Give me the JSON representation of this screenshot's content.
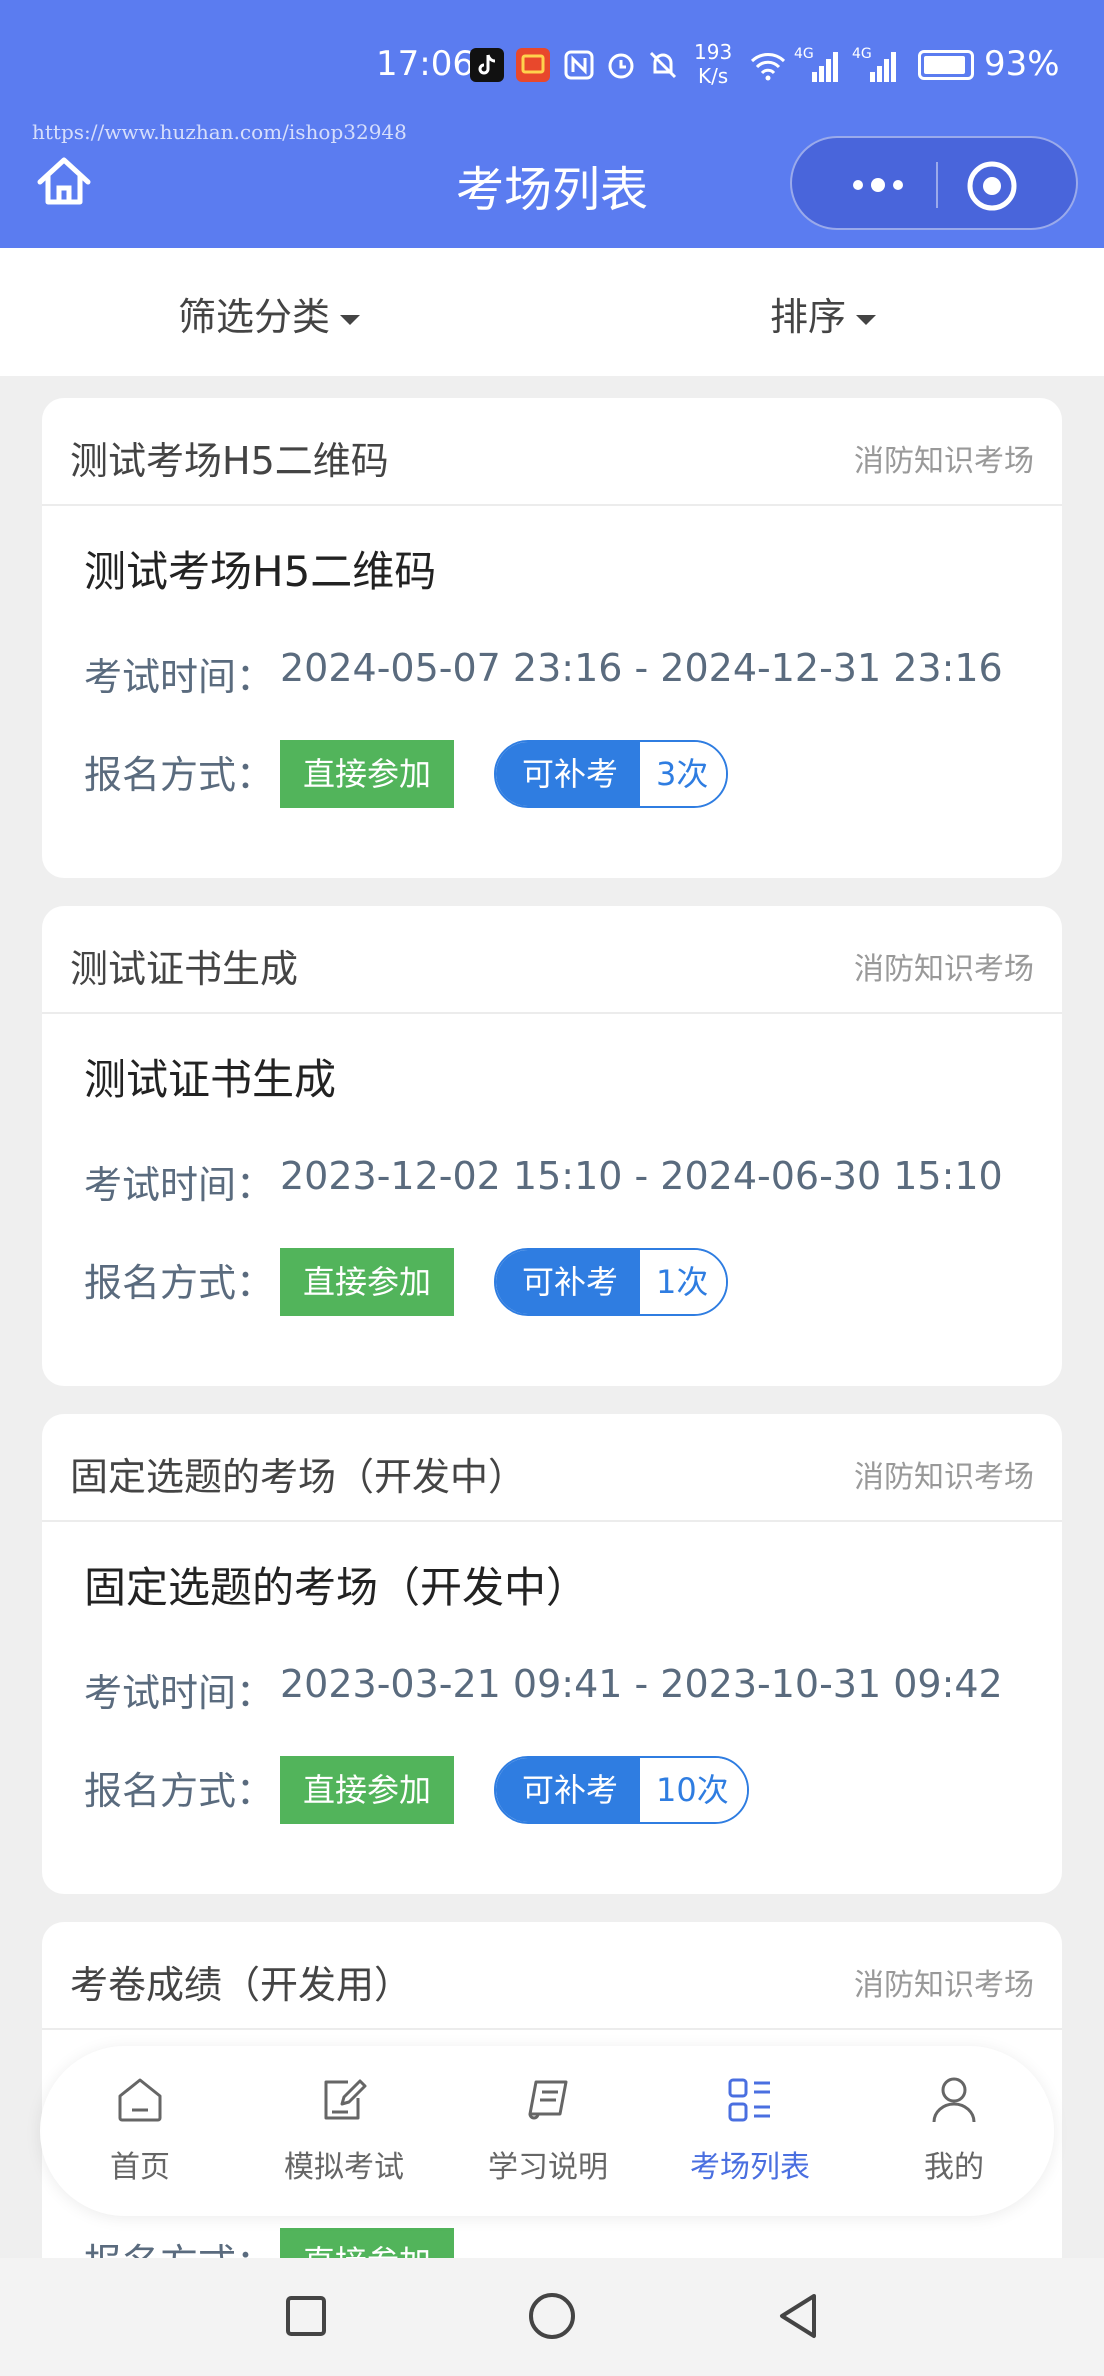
{
  "status_bar": {
    "time": "17:06",
    "net_speed": "193",
    "net_unit": "K/s",
    "signal1": "4G",
    "signal2": "4G",
    "battery_level": 0.93,
    "battery": "93%"
  },
  "watermark": "https://www.huzhan.com/ishop32948",
  "header": {
    "title": "考场列表"
  },
  "filters": [
    {
      "label": "筛选分类"
    },
    {
      "label": "排序"
    }
  ],
  "labels": {
    "exam_time": "考试时间：",
    "registration": "报名方式：",
    "join": "直接参加",
    "retake": "可补考"
  },
  "exams": [
    {
      "header_title": "测试考场H5二维码",
      "category": "消防知识考场",
      "name": "测试考场H5二维码",
      "time": "2024-05-07 23:16 - 2024-12-31 23:16",
      "retake_count": "3次"
    },
    {
      "header_title": "测试证书生成",
      "category": "消防知识考场",
      "name": "测试证书生成",
      "time": "2023-12-02 15:10 - 2024-06-30 15:10",
      "retake_count": "1次"
    },
    {
      "header_title": "固定选题的考场（开发中）",
      "category": "消防知识考场",
      "name": "固定选题的考场（开发中）",
      "time": "2023-03-21 09:41 - 2023-10-31 09:42",
      "retake_count": "10次"
    },
    {
      "header_title": "考卷成绩（开发用）",
      "category": "消防知识考场",
      "name": "",
      "time": "",
      "retake_count": ""
    }
  ],
  "tabbar": [
    {
      "label": "首页",
      "icon": "home-icon"
    },
    {
      "label": "模拟考试",
      "icon": "edit-icon"
    },
    {
      "label": "学习说明",
      "icon": "scroll-icon"
    },
    {
      "label": "考场列表",
      "icon": "grid-list-icon",
      "active": true
    },
    {
      "label": "我的",
      "icon": "user-icon"
    }
  ],
  "colors": {
    "header_bg": "#5b7cf0",
    "join_green": "#52b45b",
    "retake_blue": "#2f7de1",
    "active_tab": "#4a6fe0"
  }
}
